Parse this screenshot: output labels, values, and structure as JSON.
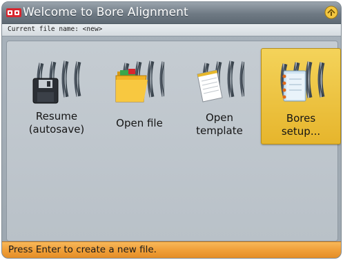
{
  "window": {
    "title": "Welcome to Bore Alignment",
    "logo_icon": "bore-alignment-logo-icon",
    "corner_icon": "scale-help-icon"
  },
  "file": {
    "current_file_label": "Current file name: <new>"
  },
  "menu": {
    "items": [
      {
        "label": "Resume\n(autosave)",
        "icon": "floppy-disk-icon",
        "selected": false
      },
      {
        "label": "Open file",
        "icon": "folder-icon",
        "selected": false
      },
      {
        "label": "Open\ntemplate",
        "icon": "template-document-icon",
        "selected": false
      },
      {
        "label": "Bores\nsetup...",
        "icon": "notebook-icon",
        "selected": true
      }
    ]
  },
  "status": {
    "message": "Press Enter to create a new file."
  },
  "colors": {
    "selected_tile": "#e9bb36",
    "status_bar": "#f0a03a",
    "title_bar": "#6f7a84"
  }
}
